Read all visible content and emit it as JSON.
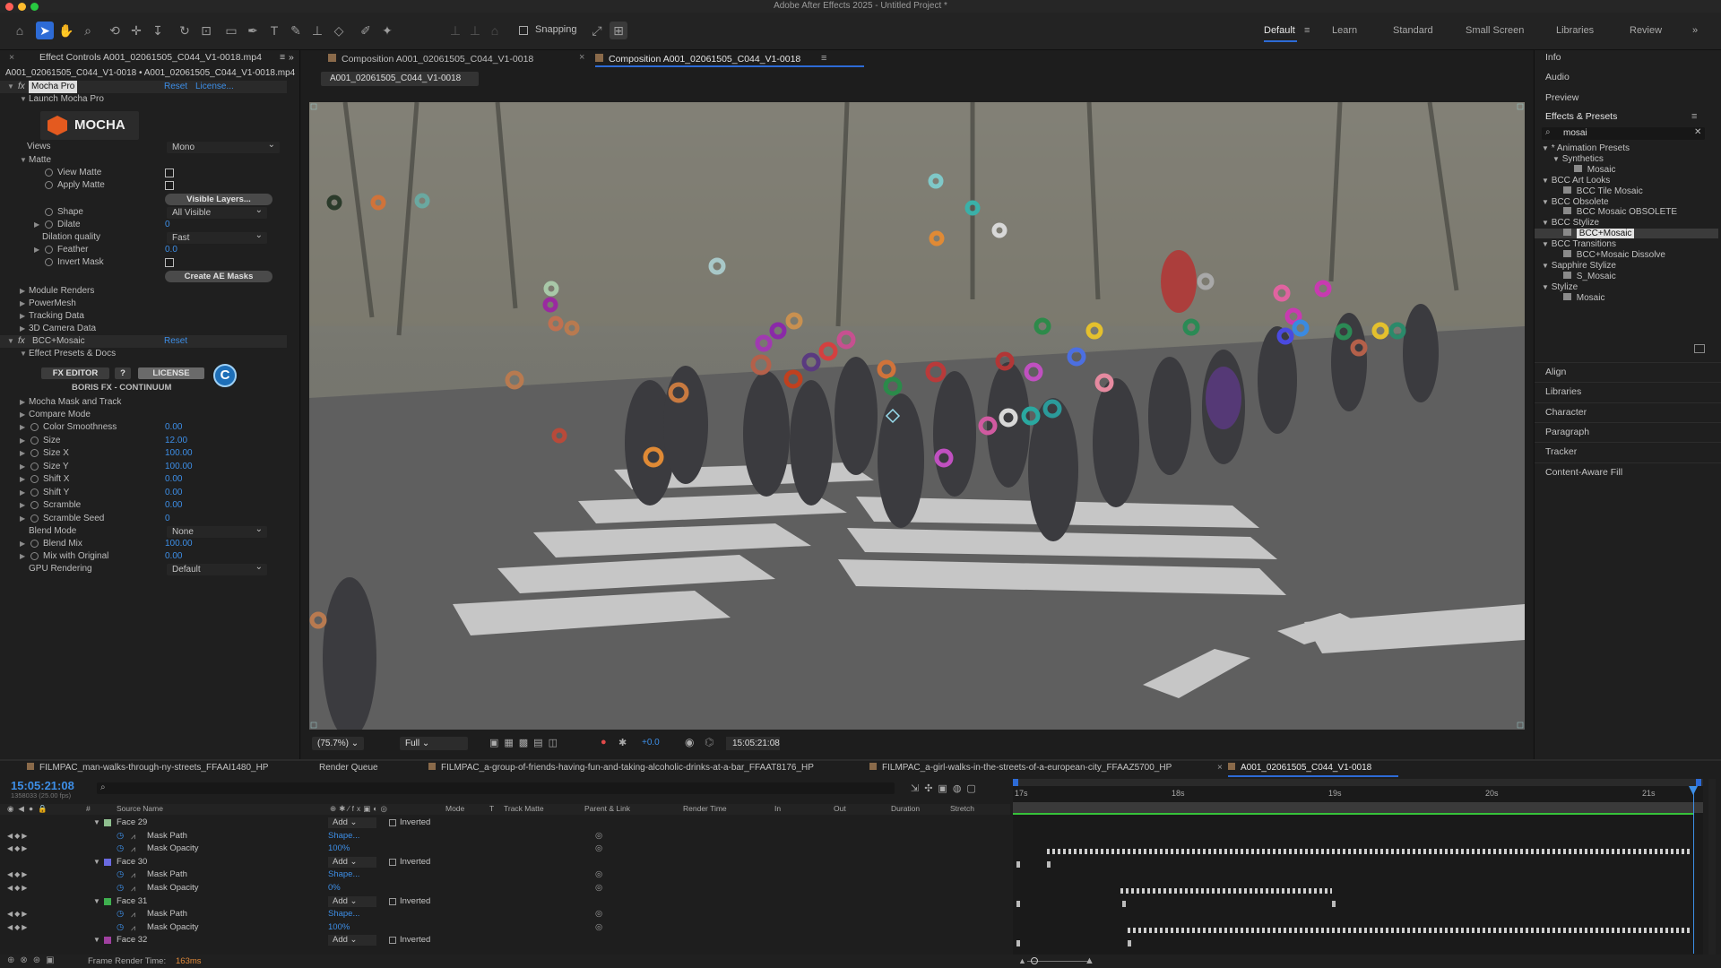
{
  "window": {
    "title": "Adobe After Effects 2025 - Untitled Project *"
  },
  "toolbar": {
    "snapping_label": "Snapping",
    "workspaces": [
      "Default",
      "Learn",
      "Standard",
      "Small Screen",
      "Libraries",
      "Review"
    ],
    "active_workspace": "Default"
  },
  "effect_controls": {
    "tab_label": "Effect Controls A001_02061505_C044_V1-0018.mp4",
    "breadcrumb": "A001_02061505_C044_V1-0018 • A001_02061505_C044_V1-0018.mp4",
    "mocha": {
      "effect_name": "Mocha Pro",
      "reset": "Reset",
      "license": "License...",
      "launch": "Launch Mocha Pro",
      "logo_text": "MOCHA",
      "views_label": "Views",
      "views_value": "Mono",
      "matte": "Matte",
      "view_matte": "View Matte",
      "apply_matte": "Apply Matte",
      "visible_layers_btn": "Visible Layers...",
      "shape_label": "Shape",
      "shape_value": "All Visible",
      "dilate_label": "Dilate",
      "dilate_value": "0",
      "dilation_quality_label": "Dilation quality",
      "dilation_quality_value": "Fast",
      "feather_label": "Feather",
      "feather_value": "0.0",
      "invert_mask": "Invert Mask",
      "create_masks_btn": "Create AE Masks",
      "module_renders": "Module Renders",
      "powermesh": "PowerMesh",
      "tracking_data": "Tracking Data",
      "camera_data": "3D Camera Data"
    },
    "bcc": {
      "effect_name": "BCC+Mosaic",
      "reset": "Reset",
      "presets_docs": "Effect Presets & Docs",
      "fx_editor": "FX EDITOR",
      "help": "?",
      "license": "LICENSE",
      "brand": "BORIS FX - CONTINUUM",
      "mocha_mask_track": "Mocha Mask and Track",
      "compare_mode": "Compare Mode",
      "params": [
        {
          "label": "Color Smoothness",
          "value": "0.00"
        },
        {
          "label": "Size",
          "value": "12.00"
        },
        {
          "label": "Size X",
          "value": "100.00"
        },
        {
          "label": "Size Y",
          "value": "100.00"
        },
        {
          "label": "Shift X",
          "value": "0.00"
        },
        {
          "label": "Shift Y",
          "value": "0.00"
        },
        {
          "label": "Scramble",
          "value": "0.00"
        },
        {
          "label": "Scramble Seed",
          "value": "0"
        }
      ],
      "blend_mode_label": "Blend Mode",
      "blend_mode_value": "None",
      "blend_mix_label": "Blend Mix",
      "blend_mix_value": "100.00",
      "mix_original_label": "Mix with Original",
      "mix_original_value": "0.00",
      "gpu_label": "GPU Rendering",
      "gpu_value": "Default"
    }
  },
  "composition": {
    "tab1": "Composition A001_02061505_C044_V1-0018",
    "tab2": "Composition A001_02061505_C044_V1-0018",
    "sub_tab": "A001_02061505_C044_V1-0018",
    "zoom": "(75.7%)",
    "resolution": "Full",
    "exposure": "+0.0",
    "timecode": "15:05:21:08"
  },
  "right_panel": {
    "top_items": [
      "Info",
      "Audio",
      "Preview"
    ],
    "effects_title": "Effects & Presets",
    "search_value": "mosai",
    "tree": [
      {
        "label": "* Animation Presets",
        "level": 0,
        "type": "folder"
      },
      {
        "label": "Synthetics",
        "level": 1,
        "type": "folder"
      },
      {
        "label": "Mosaic",
        "level": 2,
        "type": "item"
      },
      {
        "label": "BCC Art Looks",
        "level": 0,
        "type": "folder"
      },
      {
        "label": "BCC Tile Mosaic",
        "level": 1,
        "type": "item"
      },
      {
        "label": "BCC Obsolete",
        "level": 0,
        "type": "folder"
      },
      {
        "label": "BCC Mosaic OBSOLETE",
        "level": 1,
        "type": "item"
      },
      {
        "label": "BCC Stylize",
        "level": 0,
        "type": "folder"
      },
      {
        "label": "BCC+Mosaic",
        "level": 1,
        "type": "item",
        "selected": true
      },
      {
        "label": "BCC Transitions",
        "level": 0,
        "type": "folder"
      },
      {
        "label": "BCC+Mosaic Dissolve",
        "level": 1,
        "type": "item"
      },
      {
        "label": "Sapphire Stylize",
        "level": 0,
        "type": "folder"
      },
      {
        "label": "S_Mosaic",
        "level": 1,
        "type": "item"
      },
      {
        "label": "Stylize",
        "level": 0,
        "type": "folder"
      },
      {
        "label": "Mosaic",
        "level": 1,
        "type": "item"
      }
    ],
    "bottom_items": [
      "Align",
      "Libraries",
      "Character",
      "Paragraph",
      "Tracker",
      "Content-Aware Fill"
    ]
  },
  "timeline": {
    "tabs": [
      "FILMPAC_man-walks-through-ny-streets_FFAAI1480_HP",
      "Render Queue",
      "FILMPAC_a-group-of-friends-having-fun-and-taking-alcoholic-drinks-at-a-bar_FFAAT8176_HP",
      "FILMPAC_a-girl-walks-in-the-streets-of-a-european-city_FFAAZ5700_HP",
      "A001_02061505_C044_V1-0018"
    ],
    "timecode": "15:05:21:08",
    "frame_info": "1358033 (25.00 fps)",
    "columns": [
      "#",
      "Source Name",
      "Mode",
      "T",
      "Track Matte",
      "Parent & Link",
      "Render Time",
      "In",
      "Out",
      "Duration",
      "Stretch"
    ],
    "ruler": [
      "17s",
      "18s",
      "19s",
      "20s",
      "21s"
    ],
    "layers": [
      {
        "kind": "face",
        "name": "Face 29",
        "mode": "Add",
        "inverted": "Inverted",
        "color": "#8fbf8f"
      },
      {
        "kind": "prop",
        "name": "Mask Path",
        "value": "Shape..."
      },
      {
        "kind": "prop",
        "name": "Mask Opacity",
        "value": "100%"
      },
      {
        "kind": "face",
        "name": "Face 30",
        "mode": "Add",
        "inverted": "Inverted",
        "color": "#6a6ae0"
      },
      {
        "kind": "prop",
        "name": "Mask Path",
        "value": "Shape..."
      },
      {
        "kind": "prop",
        "name": "Mask Opacity",
        "value": "0%"
      },
      {
        "kind": "face",
        "name": "Face 31",
        "mode": "Add",
        "inverted": "Inverted",
        "color": "#3fb04f"
      },
      {
        "kind": "prop",
        "name": "Mask Path",
        "value": "Shape..."
      },
      {
        "kind": "prop",
        "name": "Mask Opacity",
        "value": "100%"
      },
      {
        "kind": "face",
        "name": "Face 32",
        "mode": "Add",
        "inverted": "Inverted",
        "color": "#a040a0"
      }
    ],
    "frame_render_label": "Frame Render Time:",
    "frame_render_value": "163ms"
  },
  "colors": {
    "accent": "#2d6bd6",
    "value_blue": "#3d8ee6",
    "timecode": "#3d8ee6"
  }
}
